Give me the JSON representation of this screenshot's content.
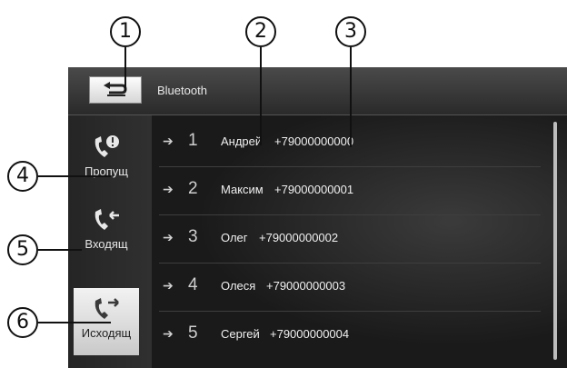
{
  "callouts": [
    "1",
    "2",
    "3",
    "4",
    "5",
    "6"
  ],
  "header": {
    "title": "Bluetooth",
    "back_icon": "back-arrow-icon"
  },
  "sidebar": {
    "items": [
      {
        "label": "Пропущ",
        "icon": "missed-call-icon",
        "active": false
      },
      {
        "label": "Входящ",
        "icon": "incoming-call-icon",
        "active": false
      },
      {
        "label": "Исходящ",
        "icon": "outgoing-call-icon",
        "active": true
      }
    ]
  },
  "calls": [
    {
      "num": "1",
      "name": "Андрей",
      "phone": "+79000000000"
    },
    {
      "num": "2",
      "name": "Максим",
      "phone": "+79000000001"
    },
    {
      "num": "3",
      "name": "Олег",
      "phone": "+79000000002"
    },
    {
      "num": "4",
      "name": "Олеся",
      "phone": "+79000000003"
    },
    {
      "num": "5",
      "name": "Сергей",
      "phone": "+79000000004"
    }
  ],
  "arrow_glyph": "➔"
}
